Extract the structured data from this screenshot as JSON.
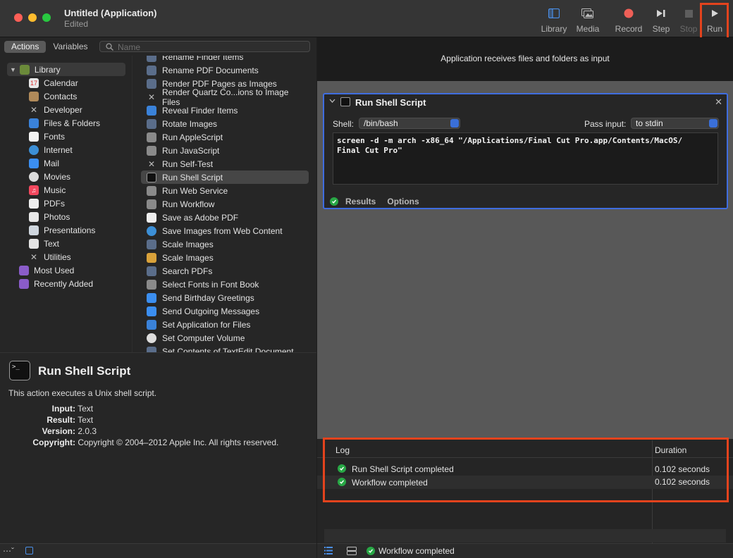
{
  "window": {
    "title": "Untitled (Application)",
    "subtitle": "Edited"
  },
  "toolbar": {
    "library": "Library",
    "media": "Media",
    "record": "Record",
    "step": "Step",
    "stop": "Stop",
    "run": "Run"
  },
  "scope": {
    "actions": "Actions",
    "variables": "Variables",
    "search_placeholder": "Name"
  },
  "categories": {
    "library": "Library",
    "items": [
      "Calendar",
      "Contacts",
      "Developer",
      "Files & Folders",
      "Fonts",
      "Internet",
      "Mail",
      "Movies",
      "Music",
      "PDFs",
      "Photos",
      "Presentations",
      "Text",
      "Utilities"
    ],
    "most_used": "Most Used",
    "recently_added": "Recently Added"
  },
  "actions": [
    "Rename Finder Items",
    "Rename PDF Documents",
    "Render PDF Pages as Images",
    "Render Quartz Co...ions to Image Files",
    "Reveal Finder Items",
    "Rotate Images",
    "Run AppleScript",
    "Run JavaScript",
    "Run Self-Test",
    "Run Shell Script",
    "Run Web Service",
    "Run Workflow",
    "Save as Adobe PDF",
    "Save Images from Web Content",
    "Scale Images",
    "Scale Images",
    "Search PDFs",
    "Select Fonts in Font Book",
    "Send Birthday Greetings",
    "Send Outgoing Messages",
    "Set Application for Files",
    "Set Computer Volume",
    "Set Contents of TextEdit Document"
  ],
  "description": {
    "title": "Run Shell Script",
    "text": "This action executes a Unix shell script.",
    "input_label": "Input:",
    "input": "Text",
    "result_label": "Result:",
    "result": "Text",
    "version_label": "Version:",
    "version": "2.0.3",
    "copyright_label": "Copyright:",
    "copyright": "Copyright © 2004–2012 Apple Inc.  All rights reserved."
  },
  "workflow": {
    "input_banner": "Application receives files and folders as input",
    "action": {
      "title": "Run Shell Script",
      "shell_label": "Shell:",
      "shell": "/bin/bash",
      "pass_label": "Pass input:",
      "pass": "to stdin",
      "script": "screen -d -m arch -x86_64 \"/Applications/Final Cut Pro.app/Contents/MacOS/\nFinal Cut Pro\"",
      "results_tab": "Results",
      "options_tab": "Options"
    }
  },
  "log": {
    "col_log": "Log",
    "col_duration": "Duration",
    "rows": [
      {
        "message": "Run Shell Script completed",
        "duration": "0.102 seconds"
      },
      {
        "message": "Workflow completed",
        "duration": "0.102 seconds"
      }
    ]
  },
  "status": {
    "text": "Workflow completed"
  },
  "colors": {
    "accent": "#3f6de0",
    "highlight": "#e3431d",
    "success": "#28a745",
    "record": "#ee5f57"
  }
}
